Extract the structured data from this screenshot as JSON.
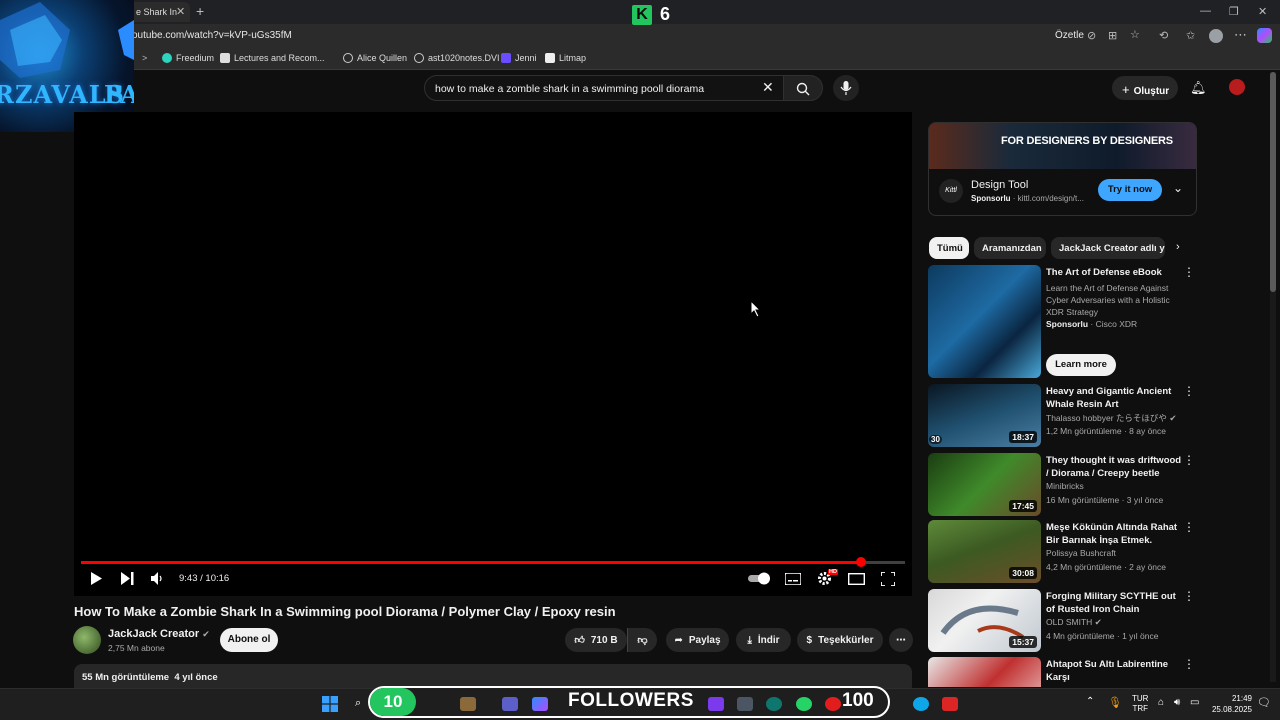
{
  "browser": {
    "tab_title": "e Shark In",
    "url": "outube.com/watch?v=kVP-uGs35fM",
    "ozetle_label": "Özetle",
    "bookmarks": [
      "Freedium",
      "Lectures and Recom...",
      "Alice Quillen",
      "ast1020notes.DVI",
      "Jenni",
      "Litmap"
    ]
  },
  "overlay": {
    "wolf_text": "RZAVALS",
    "wolf_text2": "PA",
    "k_letter": "K",
    "k_count": "6",
    "followers_label": "FOLLOWERS",
    "followers_start": "10",
    "followers_goal": "100"
  },
  "youtube": {
    "search_query": "how to make a zomble shark in a swimming pooll diorama",
    "create_label": "Oluştur",
    "player": {
      "time": "9:43 / 10:16",
      "progress_fraction": 0.946,
      "hd_badge": "HD"
    },
    "video": {
      "title": "How To Make a Zombie Shark In a Swimming pool Diorama / Polymer Clay / Epoxy resin",
      "channel": "JackJack Creator",
      "subscribers": "2,75 Mn abone",
      "subscribe_label": "Abone ol",
      "likes": "710 B",
      "share_label": "Paylaş",
      "download_label": "İndir",
      "thanks_label": "Teşekkürler",
      "views": "55 Mn görüntüleme",
      "age": "4 yıl önce"
    },
    "ad": {
      "banner_text": "FOR DESIGNERS BY DESIGNERS",
      "logo_text": "Kittl",
      "title": "Design Tool",
      "sponsored": "Sponsorlu",
      "domain": "kittl.com/design/t...",
      "cta": "Try it now"
    },
    "chips": [
      "Tümü",
      "Aramanızdan",
      "JackJack Creator adlı yü"
    ],
    "recommendations": [
      {
        "title": "The Art of Defense eBook",
        "desc": "Learn the Art of Defense Against Cyber Adversaries with a Holistic XDR Strategy",
        "sponsored": "Sponsorlu",
        "advertiser": "Cisco XDR",
        "cta": "Learn more"
      },
      {
        "title": "Heavy and Gigantic Ancient Whale Resin Art",
        "channel": "Thalasso hobbyer たらそほびや",
        "meta": "1,2 Mn görüntüleme · 8 ay önce",
        "duration": "18:37",
        "badge": "30"
      },
      {
        "title": "They thought it was driftwood / Diorama / Creepy beetle",
        "channel": "Minibricks",
        "meta": "16 Mn görüntüleme · 3 yıl önce",
        "duration": "17:45"
      },
      {
        "title": "Meşe Kökünün Altında Rahat Bir Barınak İnşa Etmek. Hayatta ...",
        "channel": "Polissya Bushcraft",
        "meta": "4,2 Mn görüntüleme · 2 ay önce",
        "duration": "30:08"
      },
      {
        "title": "Forging Military SCYTHE out of Rusted Iron Chain",
        "channel": "OLD SMITH",
        "meta": "4 Mn görüntüleme · 1 yıl önce",
        "duration": "15:37"
      },
      {
        "title": "Ahtapot Su Altı Labirentine Karşı",
        "channel": "",
        "meta": "",
        "duration": ""
      }
    ]
  },
  "taskbar": {
    "lang_top": "TUR",
    "lang_bottom": "TRF",
    "time": "21:49",
    "date": "25.08.2025"
  }
}
